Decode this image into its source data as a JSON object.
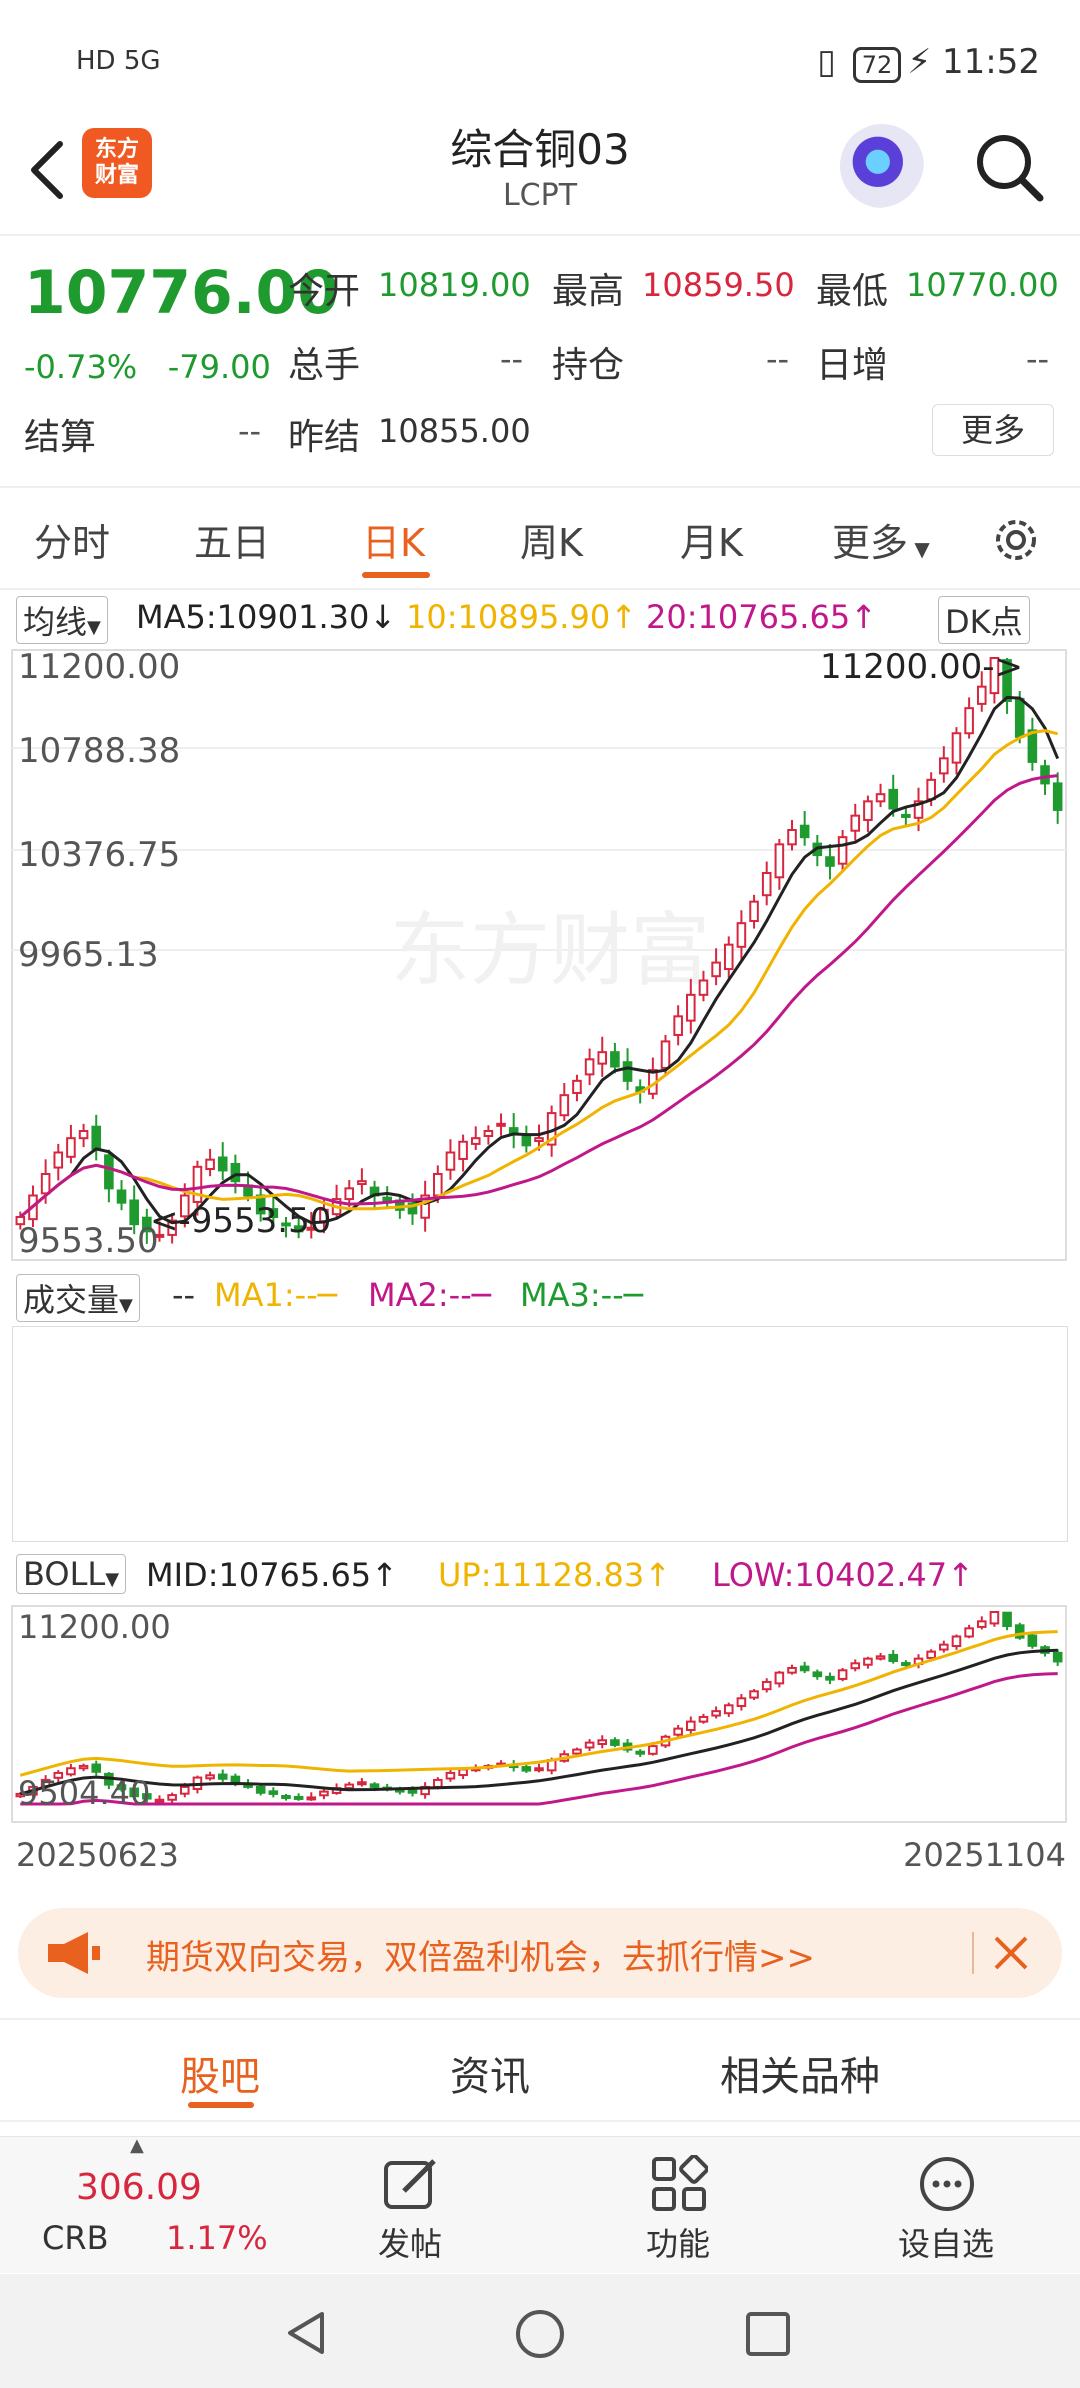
{
  "status_bar": {
    "left": "HD 5G",
    "battery": "72",
    "time": "11:52"
  },
  "header": {
    "logo_text": "东方\n财富",
    "title": "综合铜03",
    "subtitle": "LCPT"
  },
  "quote": {
    "price": "10776.00",
    "change_pct": "-0.73%",
    "change": "-79.00",
    "open_label": "今开",
    "open": "10819.00",
    "high_label": "最高",
    "high": "10859.50",
    "low_label": "最低",
    "low": "10770.00",
    "volume_label": "总手",
    "volume": "--",
    "position_label": "持仓",
    "position": "--",
    "daily_inc_label": "日增",
    "daily_inc": "--",
    "settle_label": "结算",
    "settle": "--",
    "prev_settle_label": "昨结",
    "prev_settle": "10855.00",
    "more": "更多"
  },
  "tabs": [
    "分时",
    "五日",
    "日K",
    "周K",
    "月K",
    "更多"
  ],
  "active_tab": "日K",
  "ma_row": {
    "selector": "均线",
    "ma5": "MA5:10901.30",
    "ma10": "10:10895.90",
    "ma20": "20:10765.65",
    "dk": "DK点"
  },
  "kchart": {
    "y_labels": [
      "11200.00",
      "10788.38",
      "10376.75",
      "9965.13",
      "9553.50"
    ],
    "max_marker": "11200.00->",
    "min_marker": "<-9553.50",
    "watermark": "东方财富"
  },
  "vol_row": {
    "selector": "成交量",
    "dash": "--",
    "ma1": "MA1:--",
    "ma2": "MA2:--",
    "ma3": "MA3:--"
  },
  "boll_row": {
    "selector": "BOLL",
    "mid": "MID:10765.65",
    "up": "UP:11128.83",
    "low": "LOW:10402.47"
  },
  "bollchart": {
    "y_top": "11200.00",
    "y_bottom": "9504.40"
  },
  "dates": {
    "start": "20250623",
    "end": "20251104"
  },
  "promo": {
    "text": "期货双向交易，双倍盈利机会，去抓行情>>"
  },
  "subtabs": [
    "股吧",
    "资讯",
    "相关品种"
  ],
  "bottom": {
    "crb_value": "306.09",
    "crb_name": "CRB",
    "crb_pct": "1.17%",
    "post": "发帖",
    "func": "功能",
    "fav": "设自选"
  },
  "colors": {
    "up": "#d7263d",
    "down": "#1e9a2e",
    "accent": "#e8611f",
    "ma10": "#f0b400",
    "ma20": "#c0188a"
  },
  "chart_data": {
    "type": "candlestick",
    "ylim": [
      9553.5,
      11200.0
    ],
    "close_series": [
      9640,
      9700,
      9760,
      9820,
      9860,
      9880,
      9830,
      9720,
      9680,
      9620,
      9600,
      9590,
      9630,
      9700,
      9780,
      9800,
      9770,
      9740,
      9700,
      9650,
      9640,
      9620,
      9600,
      9610,
      9660,
      9690,
      9720,
      9740,
      9700,
      9680,
      9660,
      9650,
      9700,
      9760,
      9820,
      9850,
      9860,
      9880,
      9900,
      9870,
      9840,
      9860,
      9930,
      9980,
      10020,
      10080,
      10100,
      10060,
      10020,
      9990,
      10050,
      10130,
      10200,
      10260,
      10300,
      10350,
      10400,
      10460,
      10520,
      10600,
      10680,
      10720,
      10700,
      10650,
      10620,
      10700,
      10760,
      10800,
      10820,
      10780,
      10760,
      10800,
      10860,
      10920,
      10990,
      11060,
      11120,
      11200,
      11080,
      10980,
      10910,
      10850,
      10776
    ],
    "ma5": "10901.30",
    "ma10": "10895.90",
    "ma20": "10765.65"
  }
}
